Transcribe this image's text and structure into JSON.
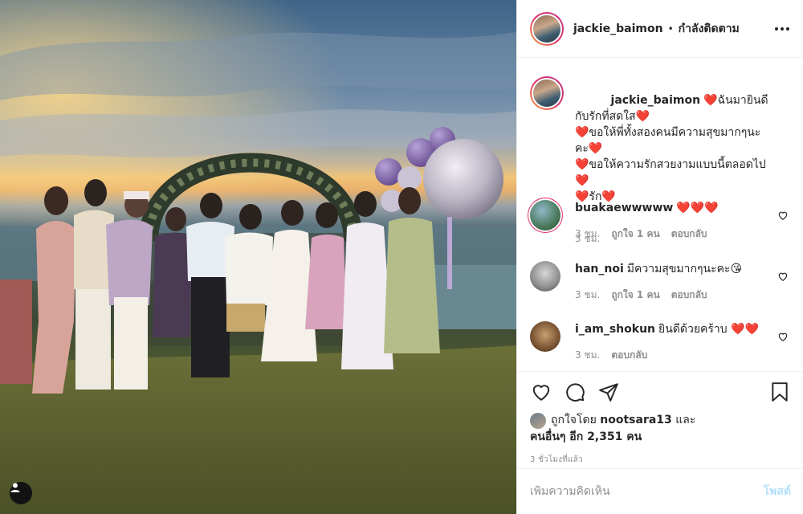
{
  "post": {
    "username": "jackie_baimon",
    "separator": "•",
    "follow_status": "กำลังติดตาม",
    "more_icon": "more-horizontal-icon"
  },
  "caption": {
    "username": "jackie_baimon",
    "text": "❤️ฉันมายินดีกับรักที่สดใส❤️\n❤️ขอให้พี่ทั้งสองคนมีความสุขมากๆนะคะ❤️\n❤️ขอให้ความรักสวยงามแบบนี้ตลอดไป❤️\n❤️รัก❤️",
    "time": "3 ชม."
  },
  "comments": [
    {
      "username": "buakaewwwww",
      "text": "❤️❤️❤️",
      "time": "3 ชม.",
      "likes": "ถูกใจ 1 คน",
      "reply": "ตอบกลับ"
    },
    {
      "username": "han_noi",
      "text": "มีความสุขมากๆนะคะ😘",
      "time": "3 ชม.",
      "likes": "ถูกใจ 1 คน",
      "reply": "ตอบกลับ"
    },
    {
      "username": "i_am_shokun",
      "text": "ยินดีด้วยคร้าบ ❤️❤️",
      "time": "3 ชม.",
      "reply": "ตอบกลับ"
    }
  ],
  "actions": {
    "like_icon": "heart-outline-icon",
    "comment_icon": "comment-bubble-icon",
    "share_icon": "paper-plane-icon",
    "save_icon": "bookmark-icon"
  },
  "likes": {
    "prefix": "ถูกใจโดย",
    "user": "nootsara13",
    "conj": "และ",
    "others": "คนอื่นๆ อีก 2,351 คน"
  },
  "time_ago": "3 ชั่วโมงที่แล้ว",
  "comment_box": {
    "placeholder": "เพิ่มความคิดเห็น",
    "post_label": "โพสต์"
  },
  "colors": {
    "heart_red": "#ed1c24",
    "post_disabled": "#b2dffc",
    "muted": "#8e8e8e"
  }
}
